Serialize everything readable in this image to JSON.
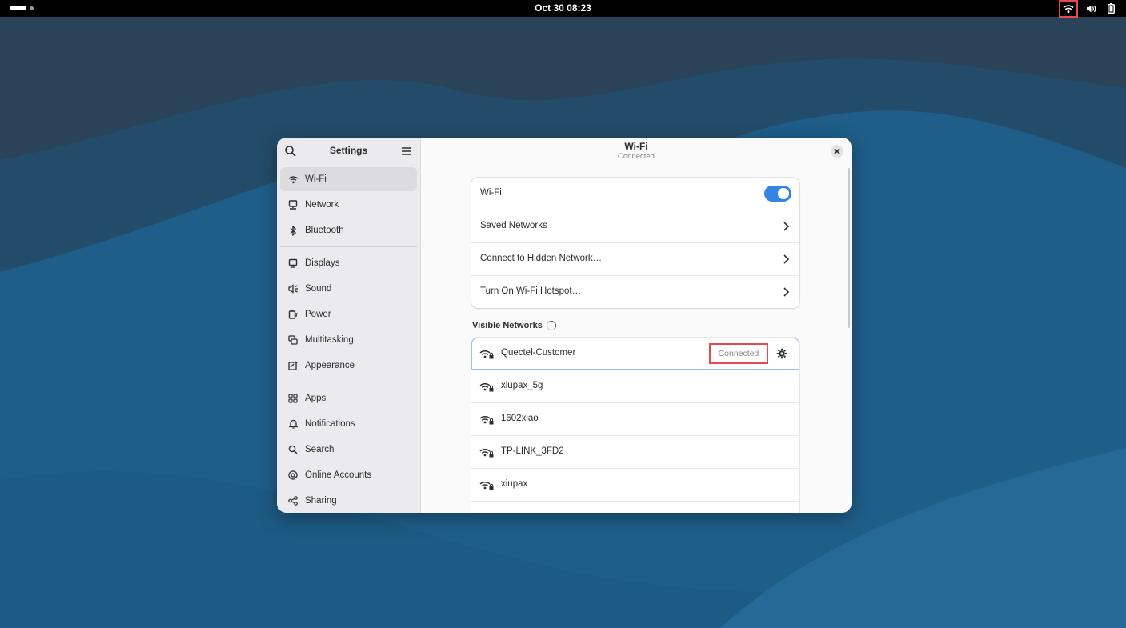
{
  "topbar": {
    "clock": "Oct 30  08:23"
  },
  "icons": {
    "wifi": "wifi-icon",
    "volume": "volume-icon",
    "battery": "battery-icon"
  },
  "accent": "#3584e4",
  "highlight": "#e8494f",
  "sidebar": {
    "title": "Settings",
    "items": [
      {
        "label": "Wi-Fi",
        "icon": "wifi-icon",
        "active": true
      },
      {
        "label": "Network",
        "icon": "network-icon"
      },
      {
        "label": "Bluetooth",
        "icon": "bluetooth-icon"
      },
      {
        "label": "Displays",
        "icon": "display-icon"
      },
      {
        "label": "Sound",
        "icon": "sound-icon"
      },
      {
        "label": "Power",
        "icon": "power-icon"
      },
      {
        "label": "Multitasking",
        "icon": "multitasking-icon"
      },
      {
        "label": "Appearance",
        "icon": "appearance-icon"
      },
      {
        "label": "Apps",
        "icon": "apps-icon"
      },
      {
        "label": "Notifications",
        "icon": "bell-icon"
      },
      {
        "label": "Search",
        "icon": "search-icon"
      },
      {
        "label": "Online Accounts",
        "icon": "at-icon"
      },
      {
        "label": "Sharing",
        "icon": "share-icon"
      }
    ]
  },
  "content": {
    "title": "Wi-Fi",
    "subtitle": "Connected",
    "wifi_toggle_label": "Wi-Fi",
    "wifi_enabled": true,
    "saved_networks": "Saved Networks",
    "hidden_network": "Connect to Hidden Network…",
    "hotspot": "Turn On Wi-Fi Hotspot…",
    "visible_networks_heading": "Visible Networks",
    "networks": [
      {
        "name": "Quectel-Customer",
        "status": "Connected"
      },
      {
        "name": "xiupax_5g"
      },
      {
        "name": "1602xiao"
      },
      {
        "name": "TP-LINK_3FD2"
      },
      {
        "name": "xiupax"
      }
    ]
  }
}
